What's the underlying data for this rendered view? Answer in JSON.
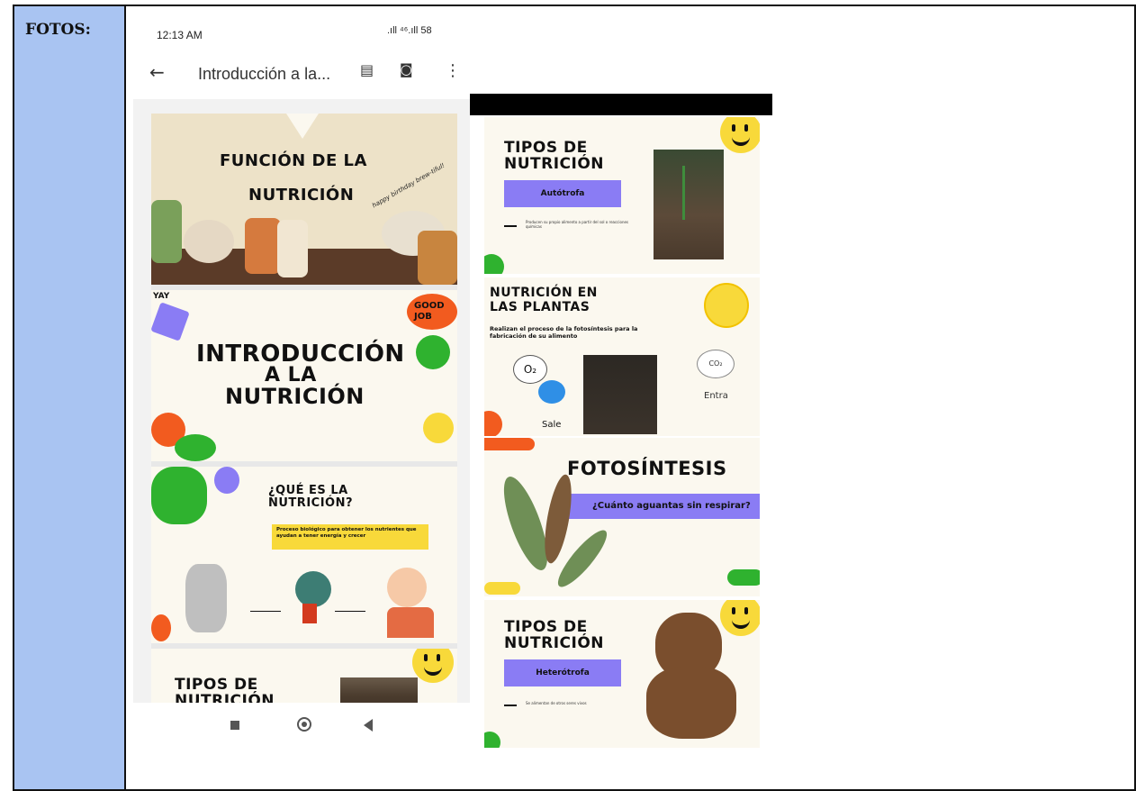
{
  "table": {
    "label": "FOTOS:"
  },
  "phone": {
    "status_time": "12:13 AM",
    "status_indicators": ".ıll ⁴⁶.ıll 58",
    "title": "Introducción a la...",
    "icons": {
      "back": "arrow-left-icon",
      "comments": "comment-icon",
      "find": "find-in-page-icon",
      "more": "more-vert-icon"
    },
    "navbar": {
      "recent": "square-icon",
      "home": "circle-icon",
      "back": "triangle-back-icon"
    }
  },
  "slides_left": [
    {
      "title_line1": "FUNCIÓN DE LA",
      "title_line2": "NUTRICIÓN",
      "script": "happy birthday brew-tiful!"
    },
    {
      "title_line1": "INTRODUCCIÓN",
      "title_line2": "A LA",
      "title_line3": "NUTRICIÓN",
      "sticker1": "YAY",
      "sticker2": "GOOD JOB"
    },
    {
      "title_line1": "¿QUÉ ES LA",
      "title_line2": "NUTRICIÓN?",
      "box_text": "Proceso biológico para obtener los nutrientes que ayudan a tener energía y crecer"
    },
    {
      "title_line1": "TIPOS DE",
      "title_line2": "NUTRICIÓN"
    }
  ],
  "slides_right": [
    {
      "title_line1": "TIPOS DE",
      "title_line2": "NUTRICIÓN",
      "button": "Autótrofa",
      "caption": "Producen su propio alimento a partir del sol o reacciones químicas"
    },
    {
      "title_line1": "NUTRICIÓN EN",
      "title_line2": "LAS PLANTAS",
      "subtitle": "Realizan el proceso de la fotosíntesis para la fabricación de su alimento",
      "o2": "O₂",
      "co2": "CO₂",
      "left_label": "Sale",
      "right_label": "Entra"
    },
    {
      "title": "FOTOSÍNTESIS",
      "question": "¿Cuánto aguantas sin respirar?"
    },
    {
      "title_line1": "TIPOS DE",
      "title_line2": "NUTRICIÓN",
      "button": "Heterótrofa",
      "caption": "Se alimentan de otros seres vivos"
    }
  ],
  "colors": {
    "label_bg": "#a9c4f2",
    "purple": "#8a7cf4",
    "yellow": "#f8d93a",
    "green": "#2fb22f",
    "orange": "#f25b1f"
  }
}
